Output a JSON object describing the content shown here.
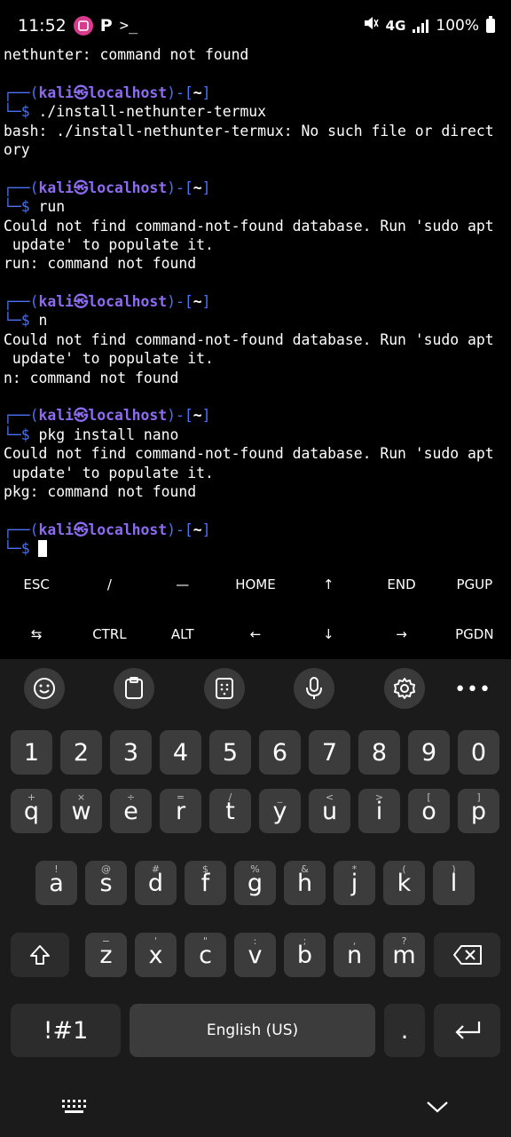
{
  "status_bar": {
    "time": "11:52",
    "app_icons": [
      "scroll-capture-icon",
      "parking-app-icon",
      "terminal-icon"
    ],
    "parking_glyph": "P",
    "terminal_glyph": ">_",
    "network": "4G",
    "battery": "100%",
    "colors": {
      "scroll_capture": "#d83a8c"
    }
  },
  "terminal": {
    "lines": [
      "nethunter: command not found",
      "",
      "PROMPT",
      "└─$ ./install-nethunter-termux",
      "bash: ./install-nethunter-termux: No such file or direct",
      "ory",
      "",
      "PROMPT",
      "└─$ run",
      "Could not find command-not-found database. Run 'sudo apt",
      " update' to populate it.",
      "run: command not found",
      "",
      "PROMPT",
      "└─$ n",
      "Could not find command-not-found database. Run 'sudo apt",
      " update' to populate it.",
      "n: command not found",
      "",
      "PROMPT",
      "└─$ pkg install nano",
      "Could not find command-not-found database. Run 'sudo apt",
      " update' to populate it.",
      "pkg: command not found",
      "",
      "PROMPT",
      "└─$ "
    ],
    "prompt": {
      "box_left": "┌──(",
      "user": "kali㉿localhost",
      "mid": ")-[",
      "dir": "~",
      "end": "]"
    },
    "colors": {
      "prompt_box": "#4a72f5",
      "prompt_user": "#8d6bf0",
      "text": "#ffffff"
    }
  },
  "extra_keys": {
    "row1": [
      "ESC",
      "/",
      "—",
      "HOME",
      "↑",
      "END",
      "PGUP"
    ],
    "row2": [
      "⇆",
      "CTRL",
      "ALT",
      "←",
      "↓",
      "→",
      "PGDN"
    ]
  },
  "keyboard": {
    "toolbar": [
      "emoji-icon",
      "clipboard-icon",
      "keypad-icon",
      "microphone-icon",
      "settings-icon",
      "more-icon"
    ],
    "more_label": "•••",
    "number_row": [
      "1",
      "2",
      "3",
      "4",
      "5",
      "6",
      "7",
      "8",
      "9",
      "0"
    ],
    "row_q": [
      {
        "k": "q",
        "h": "+"
      },
      {
        "k": "w",
        "h": "×"
      },
      {
        "k": "e",
        "h": "÷"
      },
      {
        "k": "r",
        "h": "="
      },
      {
        "k": "t",
        "h": "/"
      },
      {
        "k": "y",
        "h": "_"
      },
      {
        "k": "u",
        "h": "<"
      },
      {
        "k": "i",
        "h": ">"
      },
      {
        "k": "o",
        "h": "["
      },
      {
        "k": "p",
        "h": "]"
      }
    ],
    "row_a": [
      {
        "k": "a",
        "h": "!"
      },
      {
        "k": "s",
        "h": "@"
      },
      {
        "k": "d",
        "h": "#"
      },
      {
        "k": "f",
        "h": "$"
      },
      {
        "k": "g",
        "h": "%"
      },
      {
        "k": "h",
        "h": "&"
      },
      {
        "k": "j",
        "h": "*"
      },
      {
        "k": "k",
        "h": "("
      },
      {
        "k": "l",
        "h": ")"
      }
    ],
    "row_z": [
      {
        "k": "z",
        "h": "−"
      },
      {
        "k": "x",
        "h": "'"
      },
      {
        "k": "c",
        "h": "\""
      },
      {
        "k": "v",
        "h": ":"
      },
      {
        "k": "b",
        "h": ";"
      },
      {
        "k": "n",
        "h": ","
      },
      {
        "k": "m",
        "h": "?"
      }
    ],
    "symbols_label": "!#1",
    "space_label": "English (US)",
    "period_label": ".",
    "colors": {
      "key": "#3c3c3c",
      "key_dark": "#2c2c2c",
      "background": "#1b1b1b"
    }
  },
  "nav_bar": {
    "keyboard_switch": "keyboard-grid-icon",
    "hide": "chevron-down-icon"
  }
}
